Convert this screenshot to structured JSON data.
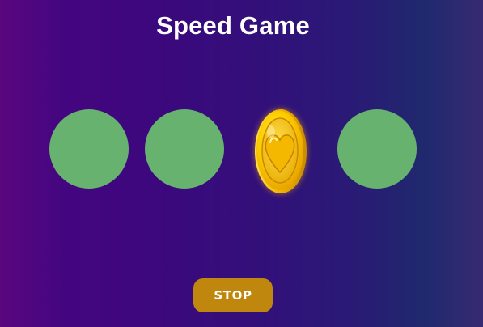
{
  "game": {
    "title": "Speed Game",
    "slots": [
      {
        "state": "empty",
        "color": "#68b26f"
      },
      {
        "state": "empty",
        "color": "#68b26f"
      },
      {
        "state": "coin",
        "icon": "heart-coin-icon",
        "color": "#f7c400"
      },
      {
        "state": "empty",
        "color": "#68b26f"
      }
    ],
    "stop_label": "STOP",
    "stop_color": "#bf870e"
  }
}
